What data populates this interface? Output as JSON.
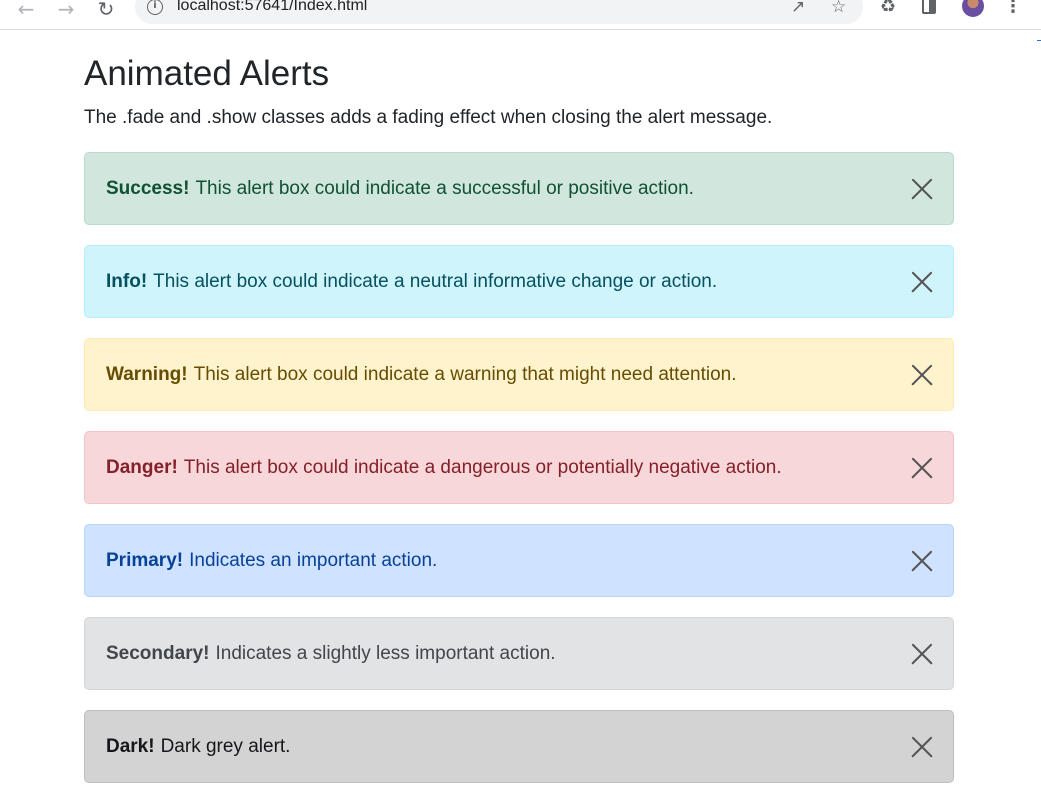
{
  "browser": {
    "url": "localhost:57641/Index.html"
  },
  "page": {
    "title": "Animated Alerts",
    "intro": "The .fade and .show classes adds a fading effect when closing the alert message."
  },
  "alerts": [
    {
      "id": "success",
      "label": "Success!",
      "text": "This alert box could indicate a successful or positive action.",
      "bg": "#d1e7dd",
      "border": "#badbcc",
      "color": "#0f5132"
    },
    {
      "id": "info",
      "label": "Info!",
      "text": "This alert box could indicate a neutral informative change or action.",
      "bg": "#cff4fc",
      "border": "#b6effb",
      "color": "#055160"
    },
    {
      "id": "warning",
      "label": "Warning!",
      "text": "This alert box could indicate a warning that might need attention.",
      "bg": "#fff3cd",
      "border": "#ffecb5",
      "color": "#664d03"
    },
    {
      "id": "danger",
      "label": "Danger!",
      "text": "This alert box could indicate a dangerous or potentially negative action.",
      "bg": "#f8d7da",
      "border": "#f5c2c7",
      "color": "#842029"
    },
    {
      "id": "primary",
      "label": "Primary!",
      "text": "Indicates an important action.",
      "bg": "#cfe2ff",
      "border": "#b6d4fe",
      "color": "#084298"
    },
    {
      "id": "secondary",
      "label": "Secondary!",
      "text": "Indicates a slightly less important action.",
      "bg": "#e2e3e5",
      "border": "#d3d6d8",
      "color": "#41464b"
    },
    {
      "id": "dark",
      "label": "Dark!",
      "text": "Dark grey alert.",
      "bg": "#d3d3d4",
      "border": "#bcbebf",
      "color": "#141619"
    }
  ],
  "icons": {
    "back": "back-arrow-icon",
    "forward": "forward-arrow-icon",
    "reload": "reload-icon",
    "info": "site-info-icon",
    "share": "share-icon",
    "star": "bookmark-star-icon",
    "extensions": "puzzle-extensions-icon",
    "panel": "side-panel-icon",
    "menu": "kebab-menu-icon",
    "close": "close-icon"
  }
}
